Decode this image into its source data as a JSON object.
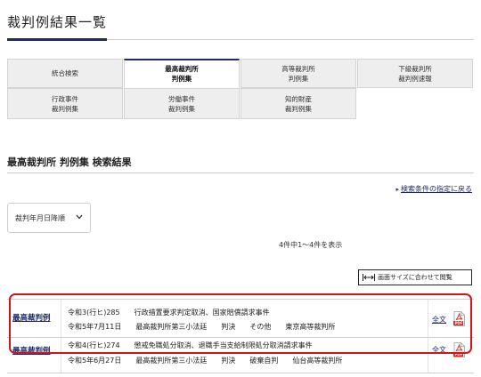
{
  "page": {
    "title": "裁判例結果一覧"
  },
  "tabs": {
    "row1": [
      {
        "line1": "統合検索",
        "line2": "",
        "active": false
      },
      {
        "line1": "最高裁判所",
        "line2": "判例集",
        "active": true
      },
      {
        "line1": "高等裁判所",
        "line2": "判例集",
        "active": false
      },
      {
        "line1": "下級裁判所",
        "line2": "裁判例速報",
        "active": false
      }
    ],
    "row2": [
      {
        "line1": "行政事件",
        "line2": "裁判例集"
      },
      {
        "line1": "労働事件",
        "line2": "裁判例集"
      },
      {
        "line1": "知的財産",
        "line2": "裁判例集"
      }
    ]
  },
  "section": {
    "title": "最高裁判所 判例集 検索結果"
  },
  "back_link": "検索条件の指定に戻る",
  "sort": {
    "selected": "裁判年月日降順"
  },
  "result_count": "4件中1～4件を表示",
  "fit_button": "画面サイズに合わせて閲覧",
  "results": [
    {
      "court": "最高裁判例",
      "line1": "令和3(行ヒ)285　　行政措置要求判定取消、国家賠償請求事件",
      "line2": "令和5年7月11日　　最高裁判所第三小法廷　　判決　　その他　　東京高等裁判所",
      "fulltext": "全文"
    },
    {
      "court": "最高裁判例",
      "line1": "令和4(行ヒ)274　　懲戒免職処分取消、退職手当支給制限処分取消請求事件",
      "line2": "令和5年6月27日　　最高裁判所第三小法廷　　判決　　破棄自判　　仙台高等裁判所",
      "fulltext": "全文"
    }
  ],
  "colors": {
    "accent": "#1c2a6b",
    "highlight": "#d0141c",
    "pdf": "#e2231a"
  },
  "icons": {
    "pdf": "pdf-icon",
    "fit": "fit-width-icon",
    "sort_arrow": "chevron-down-icon",
    "back": "chevron-right-icon"
  }
}
